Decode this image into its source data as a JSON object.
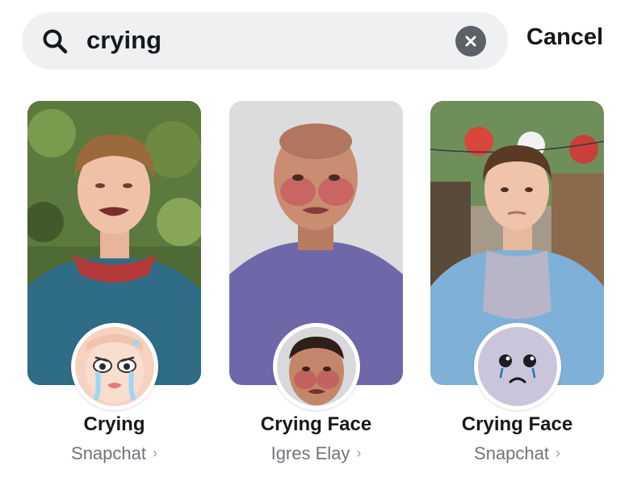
{
  "search": {
    "query": "crying",
    "clear_icon": "clear-x-icon",
    "search_icon": "search-icon",
    "cancel_label": "Cancel"
  },
  "lenses": [
    {
      "title": "Crying",
      "creator": "Snapchat",
      "icon": "crying-cartoon-face-icon"
    },
    {
      "title": "Crying Face",
      "creator": "Igres Elay",
      "icon": "crying-face-photo-icon"
    },
    {
      "title": "Crying Face",
      "creator": "Snapchat",
      "icon": "sad-face-icon"
    }
  ],
  "colors": {
    "search_bg": "#eef0f2",
    "text_primary": "#16191c",
    "text_secondary": "#6f747a"
  }
}
